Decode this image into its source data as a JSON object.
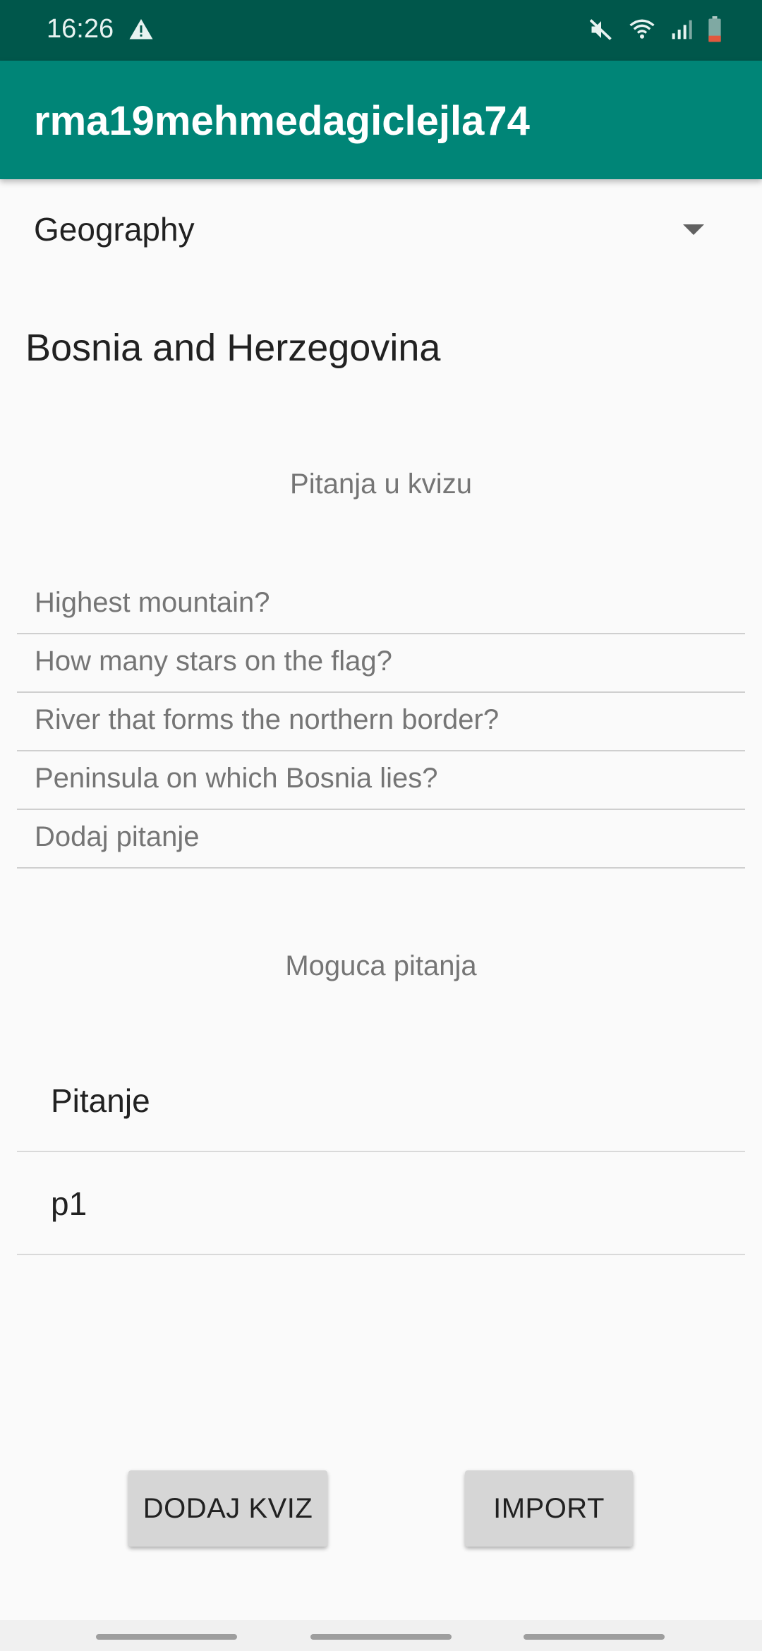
{
  "status_bar": {
    "time": "16:26",
    "icons": [
      "warning-icon",
      "mute-icon",
      "wifi-icon",
      "signal-icon",
      "battery-icon"
    ]
  },
  "app_bar": {
    "title": "rma19mehmedagiclejla74",
    "color": "#008577"
  },
  "category_spinner": {
    "selected": "Geography"
  },
  "quiz_name": "Bosnia and Herzegovina",
  "quiz_questions": {
    "header": "Pitanja u kvizu",
    "items": [
      "Highest mountain?",
      "How many stars on the flag?",
      "River that forms the northern border?",
      "Peninsula on which Bosnia lies?",
      "Dodaj pitanje"
    ]
  },
  "possible_questions": {
    "header": "Moguca pitanja",
    "items": [
      "Pitanje",
      "p1"
    ]
  },
  "buttons": {
    "add_quiz": "DODAJ KVIZ",
    "import": "IMPORT"
  }
}
